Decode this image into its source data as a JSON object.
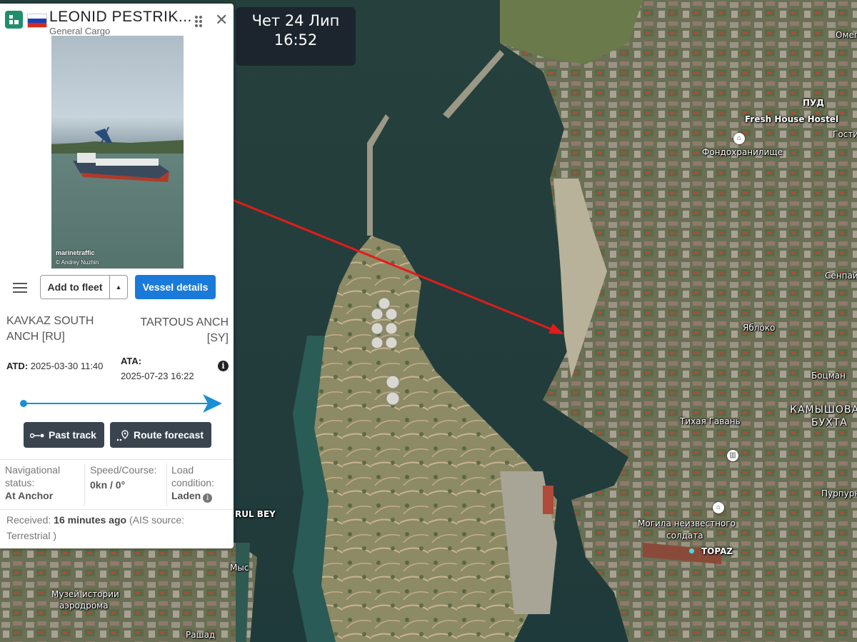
{
  "date_overlay": {
    "line1": "Чет 24 Лип",
    "line2": "16:52"
  },
  "vessel": {
    "name": "LEONID PESTRIK...",
    "type": "General Cargo",
    "flag": "russia-flag",
    "photo": {
      "watermark": "marinetraffic",
      "credit": "© Andrey Nuzhin"
    }
  },
  "buttons": {
    "add_fleet": "Add to fleet",
    "vessel_details": "Vessel details",
    "past_track": "Past track",
    "route_forecast": "Route forecast"
  },
  "voyage": {
    "departure_port": "KAVKAZ SOUTH ANCH [RU]",
    "arrival_port": "TARTOUS ANCH [SY]",
    "atd_label": "ATD:",
    "atd_value": "2025-03-30 11:40",
    "ata_label": "ATA:",
    "ata_value": "2025-07-23 16:22",
    "progress": 1.0
  },
  "status": {
    "nav_label": "Navigational status:",
    "nav_value": "At Anchor",
    "speed_label": "Speed/Course:",
    "speed_value": "0kn / 0°",
    "load_label": "Load condition:",
    "load_value": "Laden"
  },
  "received": {
    "label": "Received:",
    "value": "16 minutes ago",
    "source": "(AIS source: Terrestrial )"
  },
  "colors": {
    "accent": "#1a7ad9",
    "arrow": "#e31b1b",
    "brand": "#1f8f6b",
    "progress": "#1a8fd6"
  },
  "map_labels": {
    "omeg": "Омег",
    "pud": "ПУД",
    "fresh_house": "Fresh House Hostel",
    "gosti": "Гости",
    "fondo": "Фондохранилище",
    "senpai": "Сенпай",
    "yabloko": "Яблоко",
    "botsman": "Боцман",
    "tikhaya": "Тихая Гавань",
    "kamysh1": "КАМЫШОВА",
    "kamysh2": "БУХТА",
    "purpur": "Пурпурн",
    "mogila1": "Могила неизвестного",
    "mogila2": "солдата",
    "topaz": "TOPAZ",
    "rul_bey": "RUL BEY",
    "mys": "Мыс",
    "muzey1": "Музей истории",
    "muzey2": "аэродрома",
    "rashad": "Рашад"
  }
}
